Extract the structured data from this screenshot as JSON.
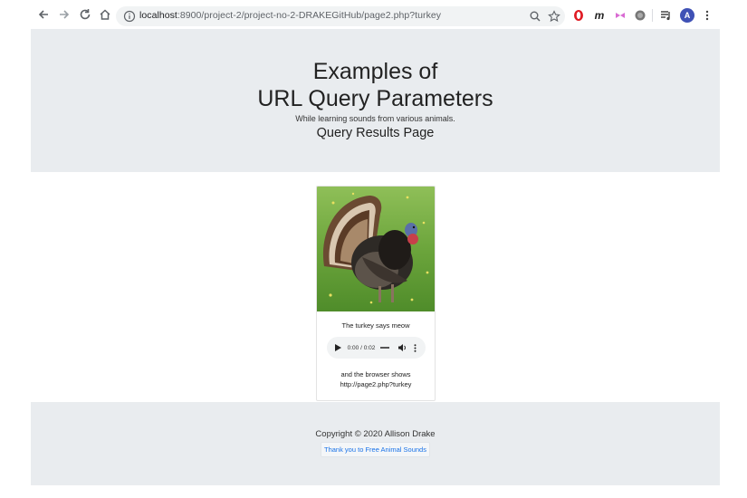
{
  "browser": {
    "url_host": "localhost",
    "url_rest": ":8900/project-2/project-no-2-DRAKEGitHub/page2.php?turkey",
    "avatar_letter": "A"
  },
  "hero": {
    "title_line1": "Examples of",
    "title_line2": "URL Query Parameters",
    "subtitle": "While learning sounds from various animals.",
    "page_heading": "Query Results Page"
  },
  "card": {
    "says_text": "The turkey says meow",
    "audio_time": "0:00 / 0:02",
    "browser_shows_line1": "and the browser shows",
    "browser_shows_line2": "http://page2.php?turkey"
  },
  "footer": {
    "copyright": "Copyright © 2020 Allison Drake",
    "thanks_link": "Thank you to Free Animal Sounds"
  },
  "colors": {
    "jumbotron_bg": "#e9ecef",
    "link": "#1a73e8",
    "avatar": "#3f51b5"
  }
}
